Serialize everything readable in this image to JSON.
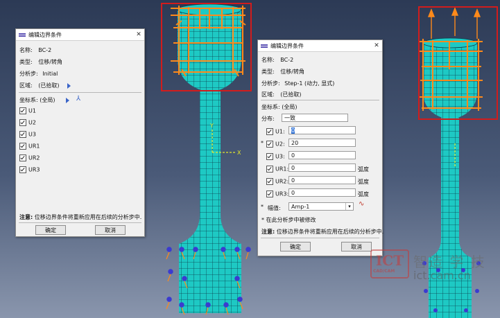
{
  "left_dialog": {
    "title": "编辑边界条件",
    "name_label": "名称:",
    "name_value": "BC-2",
    "type_label": "类型:",
    "type_value": "位移/转角",
    "step_label": "分析步:",
    "step_value": "Initial",
    "region_label": "区域:",
    "region_value": "(已拾取)",
    "csys_label": "坐标系:",
    "csys_value": "(全局)",
    "dofs": [
      "U1",
      "U2",
      "U3",
      "UR1",
      "UR2",
      "UR3"
    ],
    "note_label": "注意:",
    "note_text": "位移边界条件将重新应用在后续的分析步中.",
    "ok": "确定",
    "cancel": "取消"
  },
  "right_dialog": {
    "title": "编辑边界条件",
    "name_label": "名称:",
    "name_value": "BC-2",
    "type_label": "类型:",
    "type_value": "位移/转角",
    "step_label": "分析步:",
    "step_value": "Step-1 (动力, 显式)",
    "region_label": "区域:",
    "region_value": "(已拾取)",
    "csys_label": "坐标系:",
    "csys_value": "(全局)",
    "dist_label": "分布:",
    "dist_value": "一致",
    "dofs": [
      {
        "label": "U1:",
        "value": "0",
        "unit": "",
        "star": ""
      },
      {
        "label": "U2:",
        "value": "20",
        "unit": "",
        "star": "*"
      },
      {
        "label": "U3:",
        "value": "0",
        "unit": "",
        "star": ""
      },
      {
        "label": "UR1:",
        "value": "0",
        "unit": "弧度",
        "star": ""
      },
      {
        "label": "UR2:",
        "value": "0",
        "unit": "弧度",
        "star": ""
      },
      {
        "label": "UR3:",
        "value": "0",
        "unit": "弧度",
        "star": ""
      }
    ],
    "amp_star": "*",
    "amp_label": "幅值:",
    "amp_value": "Amp-1",
    "modified_note": "* 在此分析步中被修改",
    "note_label": "注意:",
    "note_text": "位移边界条件将重新应用在后续的分析步中.",
    "ok": "确定",
    "cancel": "取消"
  },
  "axis_labels": {
    "x": "X",
    "y": "Y"
  },
  "watermark": {
    "logo": "ICT",
    "sub": "CAD/CAM",
    "text": "智造 学 技",
    "url": "ict.cam.cn"
  },
  "colors": {
    "mesh": "#1ec9c4",
    "bc_markers": "#ff8a1a",
    "highlight": "#d21c1c",
    "bc_symbols": "#3b3bd0"
  }
}
